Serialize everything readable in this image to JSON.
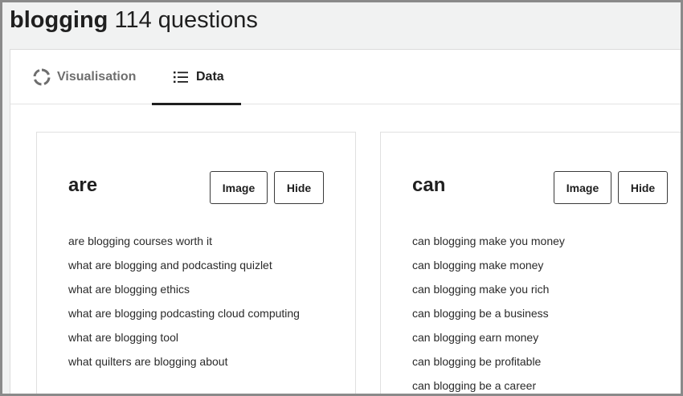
{
  "header": {
    "keyword": "blogging",
    "count_text": "114 questions"
  },
  "tabs": [
    {
      "label": "Visualisation",
      "icon": "circle-spinner-icon",
      "active": false
    },
    {
      "label": "Data",
      "icon": "list-icon",
      "active": true
    }
  ],
  "cards": [
    {
      "heading": "are",
      "image_button": "Image",
      "hide_button": "Hide",
      "questions": [
        "are blogging courses worth it",
        "what are blogging and podcasting quizlet",
        "what are blogging ethics",
        "what are blogging podcasting cloud computing",
        "what are blogging tool",
        "what quilters are blogging about"
      ]
    },
    {
      "heading": "can",
      "image_button": "Image",
      "hide_button": "Hide",
      "questions": [
        "can blogging make you money",
        "can blogging make money",
        "can blogging make you rich",
        "can blogging be a business",
        "can blogging earn money",
        "can blogging be profitable",
        "can blogging be a career"
      ]
    }
  ]
}
